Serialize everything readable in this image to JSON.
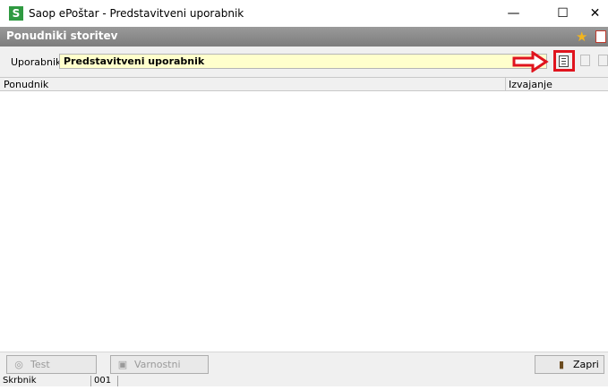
{
  "window": {
    "app_icon_letter": "S",
    "title": "Saop ePoštar - Predstavitveni uporabnik",
    "minimize_glyph": "—",
    "maximize_glyph": "☐",
    "close_glyph": "✕"
  },
  "header": {
    "title": "Ponudniki storitev",
    "star_icon": "★"
  },
  "user": {
    "label": "Uporabnik",
    "value": "Predstavitveni uporabnik"
  },
  "grid": {
    "columns": [
      "Ponudnik",
      "Izvajanje"
    ],
    "rows": []
  },
  "buttons": {
    "test": {
      "label": "Test",
      "icon": "globe-icon"
    },
    "security": {
      "label": "Varnostni sistem",
      "icon": "lock-icon"
    },
    "close": {
      "label": "Zapri",
      "icon": "door-icon"
    }
  },
  "status": {
    "label": "Skrbnik",
    "code": "001"
  },
  "colors": {
    "accent_red": "#e0141e",
    "field_background": "#ffffcc",
    "header_gray": "#8a8a8a"
  }
}
